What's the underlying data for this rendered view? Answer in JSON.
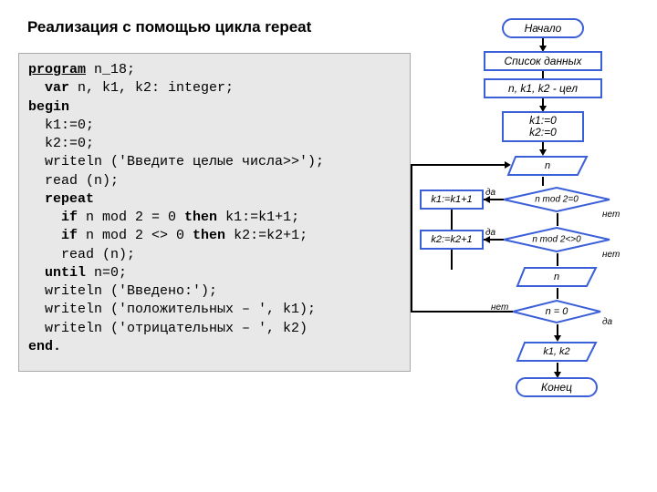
{
  "title": "Реализация с помощью цикла repeat",
  "code": {
    "l1a": "program",
    "l1b": " n_18;",
    "l2a": "  var",
    "l2b": " n, k1, k2: integer;",
    "l3": "begin",
    "l4": "  k1:=0;",
    "l5": "  k2:=0;",
    "l6": "  writeln ('Введите целые числа>>');",
    "l7": "  read (n);",
    "l8": "  repeat",
    "l9a": "    if",
    "l9b": " n mod 2 = 0 ",
    "l9c": "then",
    "l9d": " k1:=k1+1;",
    "l10a": "    if",
    "l10b": " n mod 2 <> 0 ",
    "l10c": "then",
    "l10d": " k2:=k2+1;",
    "l11": "    read (n);",
    "l12a": "  until",
    "l12b": " n=0;",
    "l13": "  writeln ('Введено:');",
    "l14": "  writeln ('положительных – ', k1);",
    "l15": "  writeln ('отрицательных – ', k2)",
    "l16": "end."
  },
  "flow": {
    "start": "Начало",
    "data_list": "Список данных",
    "vars": "n, k1, k2 - цел",
    "init1": "k1:=0",
    "init2": "k2:=0",
    "read_n": "n",
    "assign1": "k1:=k1+1",
    "assign2": "k2:=k2+1",
    "cond1": "n mod 2=0",
    "cond2": "n mod 2<>0",
    "read_n2": "n",
    "cond3": "n = 0",
    "output": "k1, k2",
    "end": "Конец",
    "yes": "да",
    "no": "нет"
  },
  "chart_data": {
    "type": "flowchart",
    "nodes": [
      {
        "id": "start",
        "shape": "rounded",
        "label": "Начало"
      },
      {
        "id": "datalist",
        "shape": "rect",
        "label": "Список данных"
      },
      {
        "id": "vars",
        "shape": "rect",
        "label": "n, k1, k2 - цел"
      },
      {
        "id": "init",
        "shape": "rect",
        "label": "k1:=0; k2:=0"
      },
      {
        "id": "read1",
        "shape": "parallelogram",
        "label": "n"
      },
      {
        "id": "cond1",
        "shape": "diamond",
        "label": "n mod 2=0"
      },
      {
        "id": "a1",
        "shape": "rect",
        "label": "k1:=k1+1"
      },
      {
        "id": "cond2",
        "shape": "diamond",
        "label": "n mod 2<>0"
      },
      {
        "id": "a2",
        "shape": "rect",
        "label": "k2:=k2+1"
      },
      {
        "id": "read2",
        "shape": "parallelogram",
        "label": "n"
      },
      {
        "id": "cond3",
        "shape": "diamond",
        "label": "n = 0"
      },
      {
        "id": "out",
        "shape": "parallelogram",
        "label": "k1, k2"
      },
      {
        "id": "end",
        "shape": "rounded",
        "label": "Конец"
      }
    ],
    "edges": [
      {
        "from": "start",
        "to": "datalist"
      },
      {
        "from": "datalist",
        "to": "vars"
      },
      {
        "from": "vars",
        "to": "init"
      },
      {
        "from": "init",
        "to": "read1"
      },
      {
        "from": "read1",
        "to": "cond1"
      },
      {
        "from": "cond1",
        "to": "a1",
        "label": "да"
      },
      {
        "from": "cond1",
        "to": "cond2",
        "label": "нет"
      },
      {
        "from": "a1",
        "to": "cond2"
      },
      {
        "from": "cond2",
        "to": "a2",
        "label": "да"
      },
      {
        "from": "cond2",
        "to": "read2",
        "label": "нет"
      },
      {
        "from": "a2",
        "to": "read2"
      },
      {
        "from": "read2",
        "to": "cond3"
      },
      {
        "from": "cond3",
        "to": "read1",
        "label": "нет"
      },
      {
        "from": "cond3",
        "to": "out",
        "label": "да"
      },
      {
        "from": "out",
        "to": "end"
      }
    ]
  }
}
